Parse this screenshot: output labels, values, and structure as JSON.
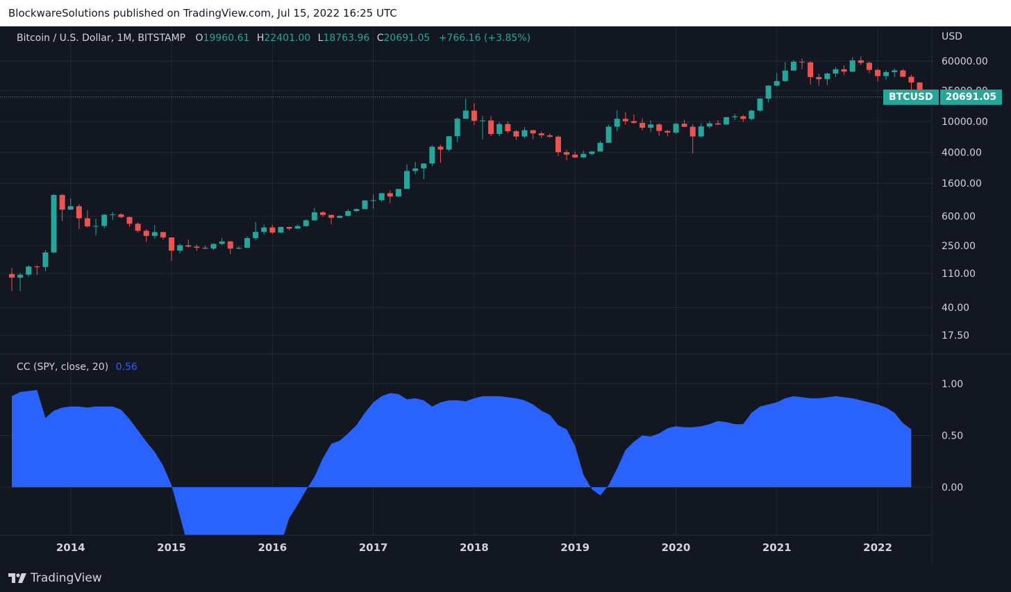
{
  "publish_header": "BlockwareSolutions published on TradingView.com, Jul 15, 2022 16:25 UTC",
  "footer": {
    "brand": "TradingView"
  },
  "colors": {
    "background": "#131722",
    "up": "#26a69a",
    "down": "#ef5350",
    "grid": "#242834",
    "area": "#2962ff",
    "text": "#d1d4dc"
  },
  "price_pane": {
    "symbol": "Bitcoin / U.S. Dollar, 1M, BITSTAMP",
    "open_label": "O",
    "open": "19960.61",
    "high_label": "H",
    "high": "22401.00",
    "low_label": "L",
    "low": "18763.96",
    "close_label": "C",
    "close": "20691.05",
    "change": "+766.16 (+3.85%)",
    "currency": "USD",
    "badge_symbol": "BTCUSD",
    "badge_price": "20691.05"
  },
  "indicator_pane": {
    "title": "CC (SPY, close, 20)",
    "value": "0.56"
  },
  "chart_data": [
    {
      "type": "candlestick",
      "title": "Bitcoin / U.S. Dollar, 1M, BITSTAMP",
      "scale": "log",
      "y_ticks": [
        "60000.00",
        "25000.00",
        "10000.00",
        "4000.00",
        "1600.00",
        "600.00",
        "250.00",
        "110.00",
        "40.00",
        "17.50"
      ],
      "y_tick_values": [
        60000,
        25000,
        10000,
        4000,
        1600,
        600,
        250,
        110,
        40,
        17.5
      ],
      "x_ticks": [
        "2014",
        "2015",
        "2016",
        "2017",
        "2018",
        "2019",
        "2020",
        "2021",
        "2022"
      ],
      "candles": [
        {
          "t": "2013-06",
          "o": 108,
          "h": 130,
          "l": 65,
          "c": 97
        },
        {
          "t": "2013-07",
          "o": 97,
          "h": 112,
          "l": 65,
          "c": 106
        },
        {
          "t": "2013-08",
          "o": 106,
          "h": 140,
          "l": 100,
          "c": 135
        },
        {
          "t": "2013-09",
          "o": 135,
          "h": 140,
          "l": 105,
          "c": 133
        },
        {
          "t": "2013-10",
          "o": 133,
          "h": 220,
          "l": 118,
          "c": 205
        },
        {
          "t": "2013-11",
          "o": 205,
          "h": 1160,
          "l": 200,
          "c": 1130
        },
        {
          "t": "2013-12",
          "o": 1130,
          "h": 1160,
          "l": 520,
          "c": 730
        },
        {
          "t": "2014-01",
          "o": 730,
          "h": 1020,
          "l": 730,
          "c": 808
        },
        {
          "t": "2014-02",
          "o": 808,
          "h": 860,
          "l": 410,
          "c": 565
        },
        {
          "t": "2014-03",
          "o": 565,
          "h": 720,
          "l": 430,
          "c": 445
        },
        {
          "t": "2014-04",
          "o": 445,
          "h": 560,
          "l": 340,
          "c": 450
        },
        {
          "t": "2014-05",
          "o": 450,
          "h": 640,
          "l": 420,
          "c": 628
        },
        {
          "t": "2014-06",
          "o": 628,
          "h": 680,
          "l": 540,
          "c": 635
        },
        {
          "t": "2014-07",
          "o": 635,
          "h": 655,
          "l": 570,
          "c": 585
        },
        {
          "t": "2014-08",
          "o": 585,
          "h": 600,
          "l": 440,
          "c": 480
        },
        {
          "t": "2014-09",
          "o": 480,
          "h": 500,
          "l": 370,
          "c": 390
        },
        {
          "t": "2014-10",
          "o": 390,
          "h": 410,
          "l": 280,
          "c": 335
        },
        {
          "t": "2014-11",
          "o": 335,
          "h": 460,
          "l": 310,
          "c": 375
        },
        {
          "t": "2014-12",
          "o": 375,
          "h": 380,
          "l": 300,
          "c": 320
        },
        {
          "t": "2015-01",
          "o": 320,
          "h": 320,
          "l": 160,
          "c": 217
        },
        {
          "t": "2015-02",
          "o": 217,
          "h": 265,
          "l": 200,
          "c": 254
        },
        {
          "t": "2015-03",
          "o": 254,
          "h": 300,
          "l": 235,
          "c": 244
        },
        {
          "t": "2015-04",
          "o": 244,
          "h": 260,
          "l": 215,
          "c": 236
        },
        {
          "t": "2015-05",
          "o": 236,
          "h": 250,
          "l": 225,
          "c": 230
        },
        {
          "t": "2015-06",
          "o": 230,
          "h": 270,
          "l": 220,
          "c": 264
        },
        {
          "t": "2015-07",
          "o": 264,
          "h": 315,
          "l": 255,
          "c": 284
        },
        {
          "t": "2015-08",
          "o": 284,
          "h": 290,
          "l": 195,
          "c": 230
        },
        {
          "t": "2015-09",
          "o": 230,
          "h": 245,
          "l": 225,
          "c": 236
        },
        {
          "t": "2015-10",
          "o": 236,
          "h": 330,
          "l": 235,
          "c": 314
        },
        {
          "t": "2015-11",
          "o": 314,
          "h": 505,
          "l": 295,
          "c": 377
        },
        {
          "t": "2015-12",
          "o": 377,
          "h": 470,
          "l": 350,
          "c": 430
        },
        {
          "t": "2016-01",
          "o": 430,
          "h": 465,
          "l": 355,
          "c": 369
        },
        {
          "t": "2016-02",
          "o": 369,
          "h": 440,
          "l": 365,
          "c": 437
        },
        {
          "t": "2016-03",
          "o": 437,
          "h": 440,
          "l": 395,
          "c": 416
        },
        {
          "t": "2016-04",
          "o": 416,
          "h": 470,
          "l": 415,
          "c": 448
        },
        {
          "t": "2016-05",
          "o": 448,
          "h": 550,
          "l": 440,
          "c": 532
        },
        {
          "t": "2016-06",
          "o": 532,
          "h": 770,
          "l": 525,
          "c": 675
        },
        {
          "t": "2016-07",
          "o": 675,
          "h": 700,
          "l": 590,
          "c": 624
        },
        {
          "t": "2016-08",
          "o": 624,
          "h": 630,
          "l": 470,
          "c": 573
        },
        {
          "t": "2016-09",
          "o": 573,
          "h": 615,
          "l": 565,
          "c": 608
        },
        {
          "t": "2016-10",
          "o": 608,
          "h": 740,
          "l": 605,
          "c": 700
        },
        {
          "t": "2016-11",
          "o": 700,
          "h": 760,
          "l": 680,
          "c": 742
        },
        {
          "t": "2016-12",
          "o": 742,
          "h": 970,
          "l": 740,
          "c": 960
        },
        {
          "t": "2017-01",
          "o": 960,
          "h": 1150,
          "l": 750,
          "c": 965
        },
        {
          "t": "2017-02",
          "o": 965,
          "h": 1200,
          "l": 920,
          "c": 1190
        },
        {
          "t": "2017-03",
          "o": 1190,
          "h": 1300,
          "l": 890,
          "c": 1080
        },
        {
          "t": "2017-04",
          "o": 1080,
          "h": 1350,
          "l": 1070,
          "c": 1350
        },
        {
          "t": "2017-05",
          "o": 1350,
          "h": 2800,
          "l": 1350,
          "c": 2300
        },
        {
          "t": "2017-06",
          "o": 2300,
          "h": 3000,
          "l": 2100,
          "c": 2480
        },
        {
          "t": "2017-07",
          "o": 2480,
          "h": 2900,
          "l": 1800,
          "c": 2870
        },
        {
          "t": "2017-08",
          "o": 2870,
          "h": 4950,
          "l": 2650,
          "c": 4730
        },
        {
          "t": "2017-09",
          "o": 4730,
          "h": 5000,
          "l": 2950,
          "c": 4340
        },
        {
          "t": "2017-10",
          "o": 4340,
          "h": 6450,
          "l": 4150,
          "c": 6450
        },
        {
          "t": "2017-11",
          "o": 6450,
          "h": 11300,
          "l": 5400,
          "c": 10850
        },
        {
          "t": "2017-12",
          "o": 10850,
          "h": 19700,
          "l": 10800,
          "c": 13800
        },
        {
          "t": "2018-01",
          "o": 13800,
          "h": 17200,
          "l": 9000,
          "c": 10200
        },
        {
          "t": "2018-02",
          "o": 10200,
          "h": 11800,
          "l": 5900,
          "c": 10300
        },
        {
          "t": "2018-03",
          "o": 10300,
          "h": 11700,
          "l": 6500,
          "c": 6900
        },
        {
          "t": "2018-04",
          "o": 6900,
          "h": 9800,
          "l": 6450,
          "c": 9240
        },
        {
          "t": "2018-05",
          "o": 9240,
          "h": 9950,
          "l": 7040,
          "c": 7490
        },
        {
          "t": "2018-06",
          "o": 7490,
          "h": 7780,
          "l": 5780,
          "c": 6390
        },
        {
          "t": "2018-07",
          "o": 6390,
          "h": 8500,
          "l": 6070,
          "c": 7730
        },
        {
          "t": "2018-08",
          "o": 7730,
          "h": 7750,
          "l": 5880,
          "c": 7020
        },
        {
          "t": "2018-09",
          "o": 7020,
          "h": 7400,
          "l": 6100,
          "c": 6630
        },
        {
          "t": "2018-10",
          "o": 6630,
          "h": 7000,
          "l": 6160,
          "c": 6370
        },
        {
          "t": "2018-11",
          "o": 6370,
          "h": 6600,
          "l": 3600,
          "c": 4020
        },
        {
          "t": "2018-12",
          "o": 4020,
          "h": 4310,
          "l": 3150,
          "c": 3740
        },
        {
          "t": "2019-01",
          "o": 3740,
          "h": 4100,
          "l": 3380,
          "c": 3440
        },
        {
          "t": "2019-02",
          "o": 3440,
          "h": 4200,
          "l": 3390,
          "c": 3820
        },
        {
          "t": "2019-03",
          "o": 3820,
          "h": 4120,
          "l": 3670,
          "c": 4100
        },
        {
          "t": "2019-04",
          "o": 4100,
          "h": 5630,
          "l": 4080,
          "c": 5300
        },
        {
          "t": "2019-05",
          "o": 5300,
          "h": 9100,
          "l": 5300,
          "c": 8560
        },
        {
          "t": "2019-06",
          "o": 8560,
          "h": 13880,
          "l": 7440,
          "c": 10820
        },
        {
          "t": "2019-07",
          "o": 10820,
          "h": 13200,
          "l": 9100,
          "c": 10080
        },
        {
          "t": "2019-08",
          "o": 10080,
          "h": 12330,
          "l": 9330,
          "c": 9600
        },
        {
          "t": "2019-09",
          "o": 9600,
          "h": 10950,
          "l": 7710,
          "c": 8300
        },
        {
          "t": "2019-10",
          "o": 8300,
          "h": 10370,
          "l": 7310,
          "c": 9150
        },
        {
          "t": "2019-11",
          "o": 9150,
          "h": 9500,
          "l": 6540,
          "c": 7550
        },
        {
          "t": "2019-12",
          "o": 7550,
          "h": 7740,
          "l": 6430,
          "c": 7190
        },
        {
          "t": "2020-01",
          "o": 7190,
          "h": 9590,
          "l": 6850,
          "c": 9350
        },
        {
          "t": "2020-02",
          "o": 9350,
          "h": 10500,
          "l": 8450,
          "c": 8540
        },
        {
          "t": "2020-03",
          "o": 8540,
          "h": 9180,
          "l": 3850,
          "c": 6410
        },
        {
          "t": "2020-04",
          "o": 6410,
          "h": 9460,
          "l": 6150,
          "c": 8630
        },
        {
          "t": "2020-05",
          "o": 8630,
          "h": 10080,
          "l": 8110,
          "c": 9450
        },
        {
          "t": "2020-06",
          "o": 9450,
          "h": 10390,
          "l": 8930,
          "c": 9140
        },
        {
          "t": "2020-07",
          "o": 9140,
          "h": 11440,
          "l": 8990,
          "c": 11350
        },
        {
          "t": "2020-08",
          "o": 11350,
          "h": 12480,
          "l": 10520,
          "c": 11660
        },
        {
          "t": "2020-09",
          "o": 11660,
          "h": 12070,
          "l": 9880,
          "c": 10780
        },
        {
          "t": "2020-10",
          "o": 10780,
          "h": 14100,
          "l": 10380,
          "c": 13800
        },
        {
          "t": "2020-11",
          "o": 13800,
          "h": 19860,
          "l": 13220,
          "c": 19700
        },
        {
          "t": "2020-12",
          "o": 19700,
          "h": 29300,
          "l": 17580,
          "c": 28990
        },
        {
          "t": "2021-01",
          "o": 28990,
          "h": 41950,
          "l": 28130,
          "c": 33140
        },
        {
          "t": "2021-02",
          "o": 33140,
          "h": 58350,
          "l": 32300,
          "c": 45240
        },
        {
          "t": "2021-03",
          "o": 45240,
          "h": 61780,
          "l": 45000,
          "c": 58790
        },
        {
          "t": "2021-04",
          "o": 58790,
          "h": 64900,
          "l": 47000,
          "c": 57720
        },
        {
          "t": "2021-05",
          "o": 57720,
          "h": 59500,
          "l": 30000,
          "c": 37300
        },
        {
          "t": "2021-06",
          "o": 37300,
          "h": 41330,
          "l": 28800,
          "c": 35040
        },
        {
          "t": "2021-07",
          "o": 35040,
          "h": 42590,
          "l": 29280,
          "c": 41460
        },
        {
          "t": "2021-08",
          "o": 41460,
          "h": 50500,
          "l": 37330,
          "c": 47100
        },
        {
          "t": "2021-09",
          "o": 47100,
          "h": 52940,
          "l": 39600,
          "c": 43820
        },
        {
          "t": "2021-10",
          "o": 43820,
          "h": 66930,
          "l": 43290,
          "c": 61300
        },
        {
          "t": "2021-11",
          "o": 61300,
          "h": 69000,
          "l": 53260,
          "c": 57000
        },
        {
          "t": "2021-12",
          "o": 57000,
          "h": 59100,
          "l": 42000,
          "c": 46200
        },
        {
          "t": "2022-01",
          "o": 46200,
          "h": 47990,
          "l": 32950,
          "c": 38480
        },
        {
          "t": "2022-02",
          "o": 38480,
          "h": 45800,
          "l": 34320,
          "c": 43190
        },
        {
          "t": "2022-03",
          "o": 43190,
          "h": 48240,
          "l": 37170,
          "c": 45530
        },
        {
          "t": "2022-04",
          "o": 45530,
          "h": 47440,
          "l": 37700,
          "c": 37640
        },
        {
          "t": "2022-05",
          "o": 37640,
          "h": 40020,
          "l": 25400,
          "c": 31800
        },
        {
          "t": "2022-06",
          "o": 31800,
          "h": 31980,
          "l": 17600,
          "c": 19930
        },
        {
          "t": "2022-07",
          "o": 19960.61,
          "h": 22401,
          "l": 18763.96,
          "c": 20691.05
        }
      ],
      "last_price": 20691.05
    },
    {
      "type": "area",
      "title": "CC (SPY, close, 20)",
      "y_ticks": [
        "1.00",
        "0.50",
        "0.00"
      ],
      "y_tick_values": [
        1,
        0.5,
        0
      ],
      "values": [
        0.88,
        0.92,
        0.93,
        0.94,
        0.67,
        0.74,
        0.77,
        0.78,
        0.78,
        0.77,
        0.78,
        0.78,
        0.78,
        0.75,
        0.66,
        0.55,
        0.44,
        0.34,
        0.21,
        0.02,
        -0.28,
        -0.58,
        -0.75,
        -0.82,
        -0.82,
        -0.82,
        -0.82,
        -0.82,
        -0.82,
        -0.82,
        -0.82,
        -0.7,
        -0.55,
        -0.3,
        -0.17,
        -0.03,
        0.1,
        0.28,
        0.42,
        0.45,
        0.52,
        0.6,
        0.72,
        0.82,
        0.88,
        0.91,
        0.9,
        0.85,
        0.86,
        0.84,
        0.78,
        0.82,
        0.84,
        0.84,
        0.83,
        0.86,
        0.88,
        0.88,
        0.88,
        0.87,
        0.86,
        0.84,
        0.8,
        0.74,
        0.7,
        0.6,
        0.56,
        0.4,
        0.12,
        -0.02,
        -0.08,
        0.02,
        0.18,
        0.36,
        0.44,
        0.5,
        0.49,
        0.52,
        0.57,
        0.59,
        0.58,
        0.58,
        0.59,
        0.61,
        0.64,
        0.63,
        0.61,
        0.61,
        0.72,
        0.78,
        0.8,
        0.82,
        0.86,
        0.88,
        0.87,
        0.86,
        0.86,
        0.87,
        0.88,
        0.87,
        0.86,
        0.84,
        0.82,
        0.8,
        0.77,
        0.72,
        0.62,
        0.56
      ]
    }
  ]
}
